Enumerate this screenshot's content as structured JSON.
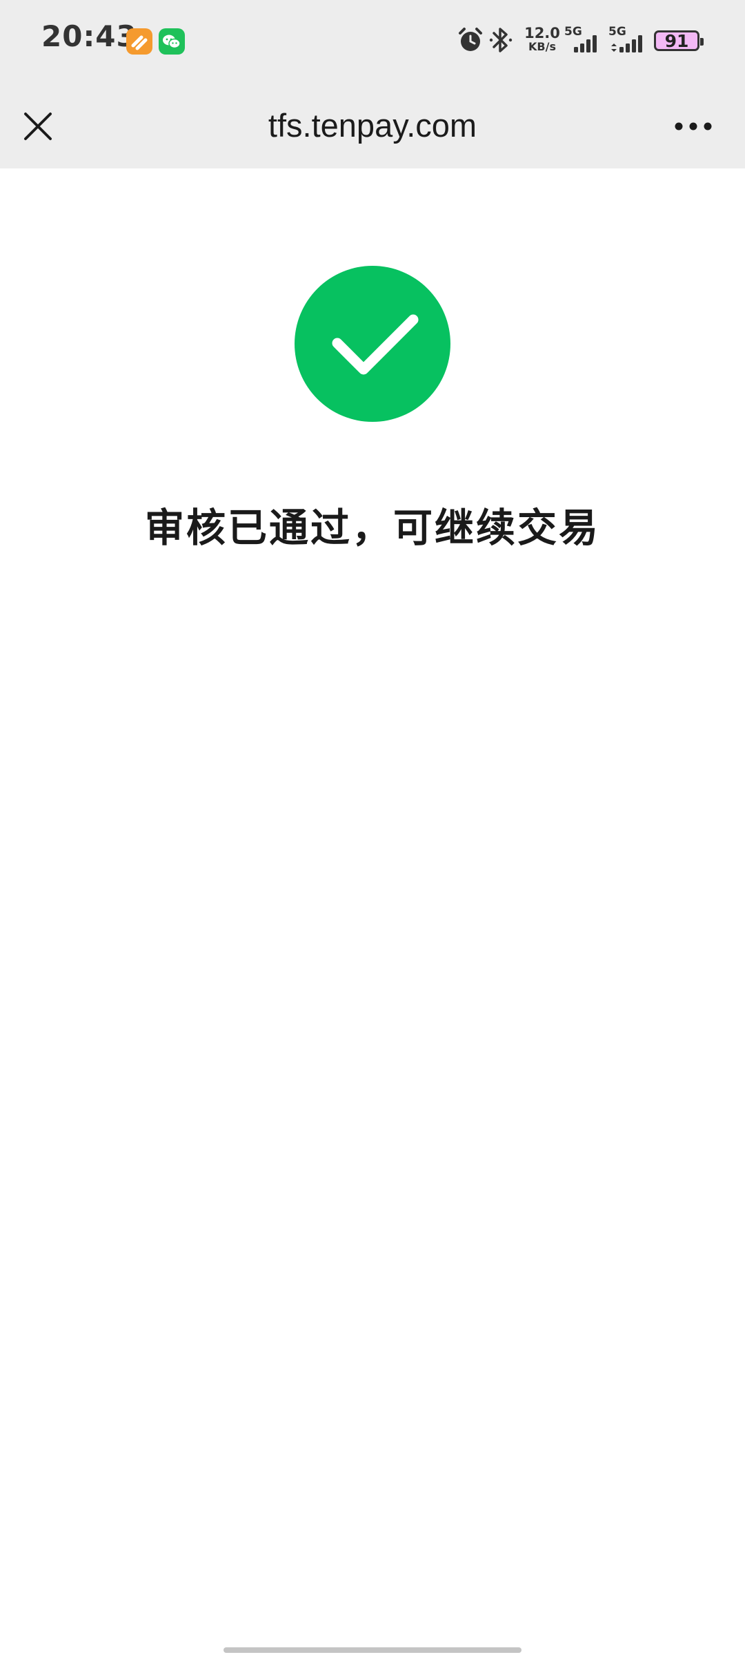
{
  "status_bar": {
    "time": "20:43",
    "app_icons": [
      "orange-app-icon",
      "wechat-icon"
    ],
    "network_speed_value": "12.0",
    "network_speed_unit": "KB/s",
    "signal1_label": "5G",
    "signal2_label": "5G",
    "battery_level": "91",
    "battery_color": "#f3b9f5"
  },
  "nav": {
    "title": "tfs.tenpay.com",
    "close_icon": "close-icon",
    "more_icon": "more-icon"
  },
  "content": {
    "status_icon": "success-check-icon",
    "status_color": "#07c160",
    "message": "审核已通过，可继续交易"
  }
}
